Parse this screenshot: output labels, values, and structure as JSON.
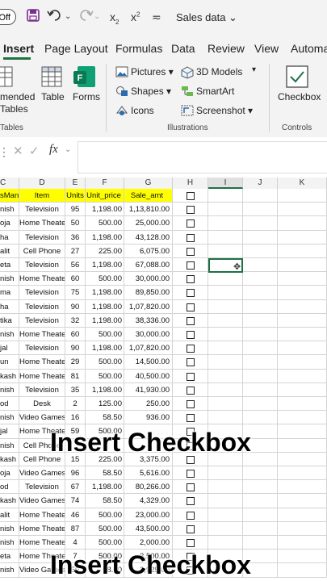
{
  "window": {
    "autosave_toggle": "Off",
    "title": "Sales data",
    "qat": [
      "save-icon",
      "undo-icon",
      "redo-icon",
      "subscript-icon",
      "superscript-icon",
      "customize-icon"
    ]
  },
  "tabs": [
    {
      "label": "Insert",
      "active": true
    },
    {
      "label": "Page Layout"
    },
    {
      "label": "Formulas"
    },
    {
      "label": "Data"
    },
    {
      "label": "Review"
    },
    {
      "label": "View"
    },
    {
      "label": "Automa"
    }
  ],
  "ribbon": {
    "tables": {
      "recommended_line1": "mended",
      "recommended_line2": "Tables",
      "table": "Table",
      "forms": "Forms",
      "group": "Tables"
    },
    "illustrations": {
      "pictures": "Pictures",
      "shapes": "Shapes",
      "icons": "Icons",
      "models": "3D Models",
      "smartart": "SmartArt",
      "screenshot": "Screenshot",
      "group": "Illustrations"
    },
    "controls": {
      "checkbox": "Checkbox",
      "group": "Controls"
    }
  },
  "formula_bar": {
    "fx": "fx",
    "value": ""
  },
  "columns": [
    "C",
    "D",
    "E",
    "F",
    "G",
    "H",
    "I",
    "J",
    "K"
  ],
  "table": {
    "headers": [
      "sMan",
      "Item",
      "Units",
      "Unit_price",
      "Sale_amt"
    ],
    "rows": [
      [
        "nish",
        "Television",
        "95",
        "1,198.00",
        "1,13,810.00"
      ],
      [
        "oja",
        "Home Theater",
        "50",
        "500.00",
        "25,000.00"
      ],
      [
        "ha",
        "Television",
        "36",
        "1,198.00",
        "43,128.00"
      ],
      [
        "alit",
        "Cell Phone",
        "27",
        "225.00",
        "6,075.00"
      ],
      [
        "eta",
        "Television",
        "56",
        "1,198.00",
        "67,088.00"
      ],
      [
        "nish",
        "Home Theater",
        "60",
        "500.00",
        "30,000.00"
      ],
      [
        "ma",
        "Television",
        "75",
        "1,198.00",
        "89,850.00"
      ],
      [
        "ha",
        "Television",
        "90",
        "1,198.00",
        "1,07,820.00"
      ],
      [
        "tika",
        "Television",
        "32",
        "1,198.00",
        "38,336.00"
      ],
      [
        "nish",
        "Home Theater",
        "60",
        "500.00",
        "30,000.00"
      ],
      [
        "jal",
        "Television",
        "90",
        "1,198.00",
        "1,07,820.00"
      ],
      [
        "un",
        "Home Theater",
        "29",
        "500.00",
        "14,500.00"
      ],
      [
        "kash",
        "Home Theater",
        "81",
        "500.00",
        "40,500.00"
      ],
      [
        "nish",
        "Television",
        "35",
        "1,198.00",
        "41,930.00"
      ],
      [
        "od",
        "Desk",
        "2",
        "125.00",
        "250.00"
      ],
      [
        "nish",
        "Video Games",
        "16",
        "58.50",
        "936.00"
      ],
      [
        "jal",
        "Home Theater",
        "59",
        "500.00",
        ""
      ],
      [
        "nish",
        "Cell Phone",
        "",
        "",
        ""
      ],
      [
        "kash",
        "Cell Phone",
        "15",
        "225.00",
        "3,375.00"
      ],
      [
        "oja",
        "Video Games",
        "96",
        "58.50",
        "5,616.00"
      ],
      [
        "od",
        "Television",
        "67",
        "1,198.00",
        "80,266.00"
      ],
      [
        "kash",
        "Video Games",
        "74",
        "58.50",
        "4,329.00"
      ],
      [
        "alit",
        "Home Theater",
        "46",
        "500.00",
        "23,000.00"
      ],
      [
        "nish",
        "Home Theater",
        "87",
        "500.00",
        "43,500.00"
      ],
      [
        "nish",
        "Home Theater",
        "4",
        "500.00",
        "2,000.00"
      ],
      [
        "eta",
        "Home Theater",
        "7",
        "500.00",
        "3,500.00"
      ],
      [
        "nish",
        "Video Games",
        "50",
        "58.50",
        "2,925.00"
      ]
    ]
  },
  "overlay": {
    "caption1": "Insert Checkbox",
    "caption2": "Insert Checkbox"
  }
}
